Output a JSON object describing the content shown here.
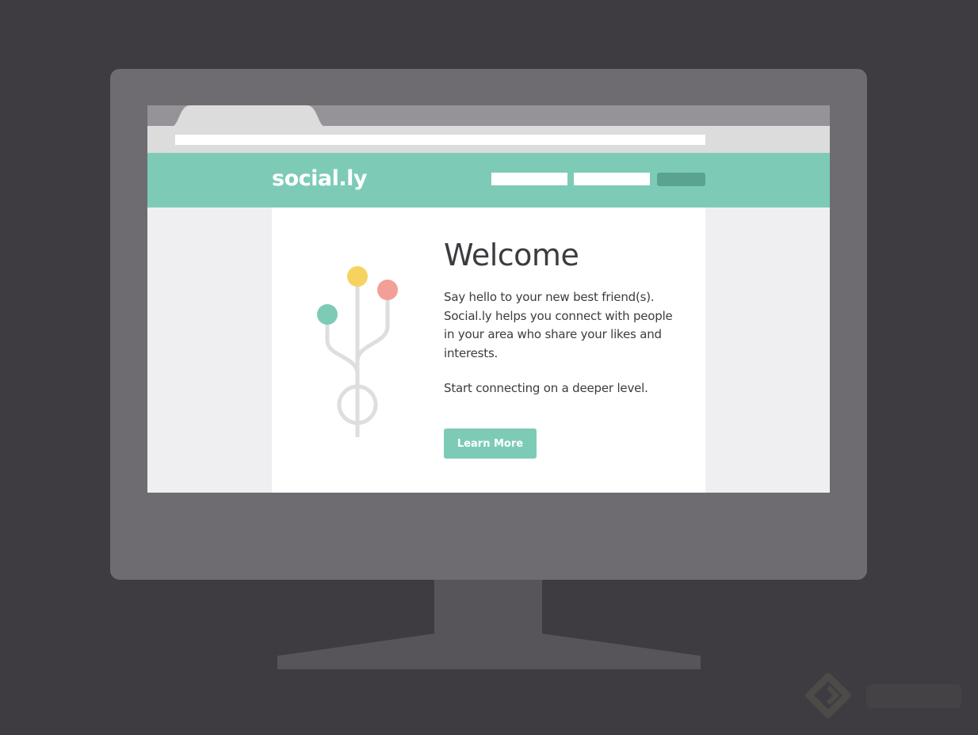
{
  "brand": {
    "name": "social.ly",
    "accent_color": "#7dcbb7",
    "nav_link_count_visible": 2
  },
  "hero": {
    "title": "Welcome",
    "body": "Say hello to your new best friend(s). Social.ly helps you connect with people in your area who share your likes and interests.",
    "tagline": "Start connecting on a deeper level.",
    "button_label": "Learn More"
  },
  "illustration": {
    "icon": "connection-tree-icon",
    "node_colors": [
      "#7dcbb7",
      "#f6d361",
      "#f29f97"
    ]
  }
}
